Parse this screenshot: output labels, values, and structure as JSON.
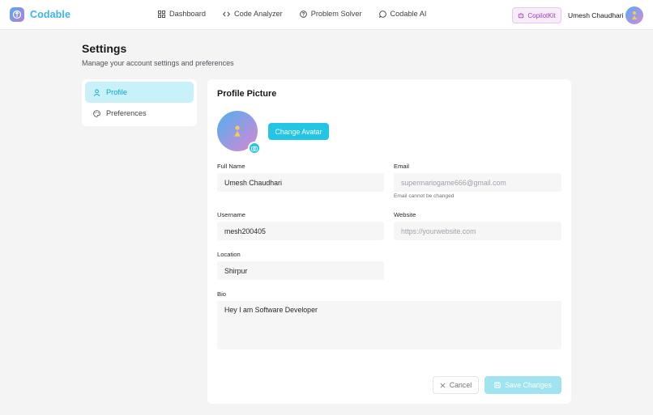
{
  "app": {
    "name": "Codable",
    "brand_color": "#3bb4e8",
    "accent_color": "#22c5e3"
  },
  "nav": {
    "items": [
      {
        "label": "Dashboard",
        "icon": "grid-icon"
      },
      {
        "label": "Code Analyzer",
        "icon": "code-icon"
      },
      {
        "label": "Problem Solver",
        "icon": "help-circle-icon"
      },
      {
        "label": "Codable AI",
        "icon": "chat-bubble-icon"
      }
    ],
    "copilot_label": "CopilotKit",
    "user_name": "Umesh Chaudhari"
  },
  "page": {
    "title": "Settings",
    "subtitle": "Manage your account settings and preferences"
  },
  "sidebar": {
    "items": [
      {
        "label": "Profile",
        "icon": "user-icon",
        "active": true
      },
      {
        "label": "Preferences",
        "icon": "palette-icon",
        "active": false
      }
    ]
  },
  "profile": {
    "section_title": "Profile Picture",
    "change_avatar_label": "Change Avatar",
    "full_name": {
      "label": "Full Name",
      "value": "Umesh Chaudhari"
    },
    "email": {
      "label": "Email",
      "value": "supermariogame666@gmail.com",
      "hint": "Email cannot be changed"
    },
    "username": {
      "label": "Username",
      "value": "mesh200405"
    },
    "website": {
      "label": "Website",
      "value": "",
      "placeholder": "https://yourwebsite.com"
    },
    "location": {
      "label": "Location",
      "value": "Shirpur"
    },
    "bio": {
      "label": "Bio",
      "value": "Hey I am Software Developer"
    }
  },
  "actions": {
    "cancel_label": "Cancel",
    "save_label": "Save Changes"
  }
}
